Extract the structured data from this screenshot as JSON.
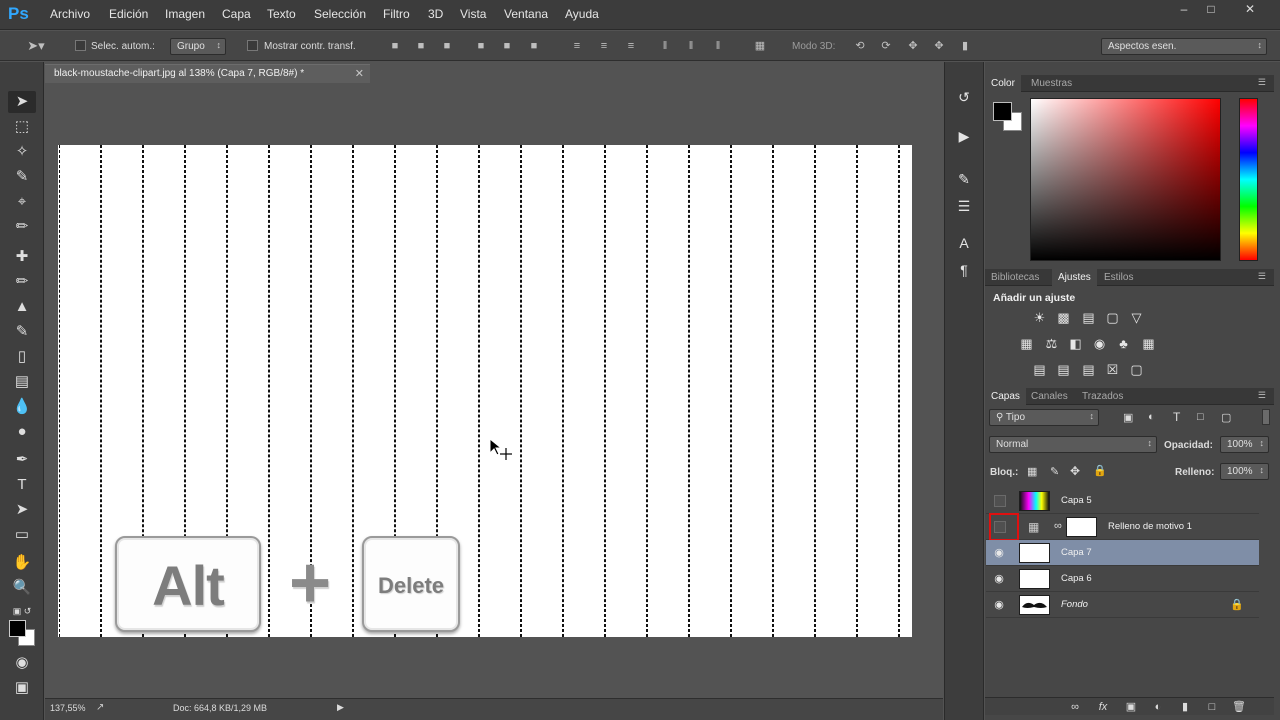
{
  "app": {
    "logo": "Ps"
  },
  "menu": [
    "Archivo",
    "Edición",
    "Imagen",
    "Capa",
    "Texto",
    "Selección",
    "Filtro",
    "3D",
    "Vista",
    "Ventana",
    "Ayuda"
  ],
  "options": {
    "auto_select_label": "Selec. autom.:",
    "auto_select_value": "Grupo",
    "show_transform_label": "Mostrar contr. transf.",
    "mode_3d_label": "Modo 3D:",
    "workspace": "Aspectos esen."
  },
  "document": {
    "tab_title": "black-moustache-clipart.jpg al 138% (Capa 7, RGB/8#) *",
    "keys": {
      "alt": "Alt",
      "plus": "+",
      "delete": "Delete"
    }
  },
  "status": {
    "zoom": "137,55%",
    "doc_size": "Doc: 664,8 KB/1,29 MB"
  },
  "color_panel": {
    "tabs": [
      "Color",
      "Muestras"
    ],
    "foreground": "#000000",
    "background": "#ffffff"
  },
  "adjust_panel": {
    "tabs": [
      "Bibliotecas",
      "Ajustes",
      "Estilos"
    ],
    "heading": "Añadir un ajuste"
  },
  "layers_panel": {
    "tabs": [
      "Capas",
      "Canales",
      "Trazados"
    ],
    "filter": "Tipo",
    "blend_mode": "Normal",
    "opacity_label": "Opacidad:",
    "opacity_value": "100%",
    "lock_label": "Bloq.:",
    "fill_label": "Relleno:",
    "fill_value": "100%",
    "layers": [
      {
        "name": "Capa 5",
        "visible": false
      },
      {
        "name": "Relleno de motivo 1",
        "visible": false
      },
      {
        "name": "Capa 7",
        "visible": true,
        "selected": true
      },
      {
        "name": "Capa 6",
        "visible": true
      },
      {
        "name": "Fondo",
        "visible": true,
        "locked": true
      }
    ]
  },
  "icons": {
    "move_tool": "move-icon",
    "lock": "lock-icon",
    "eye": "eye-icon"
  }
}
